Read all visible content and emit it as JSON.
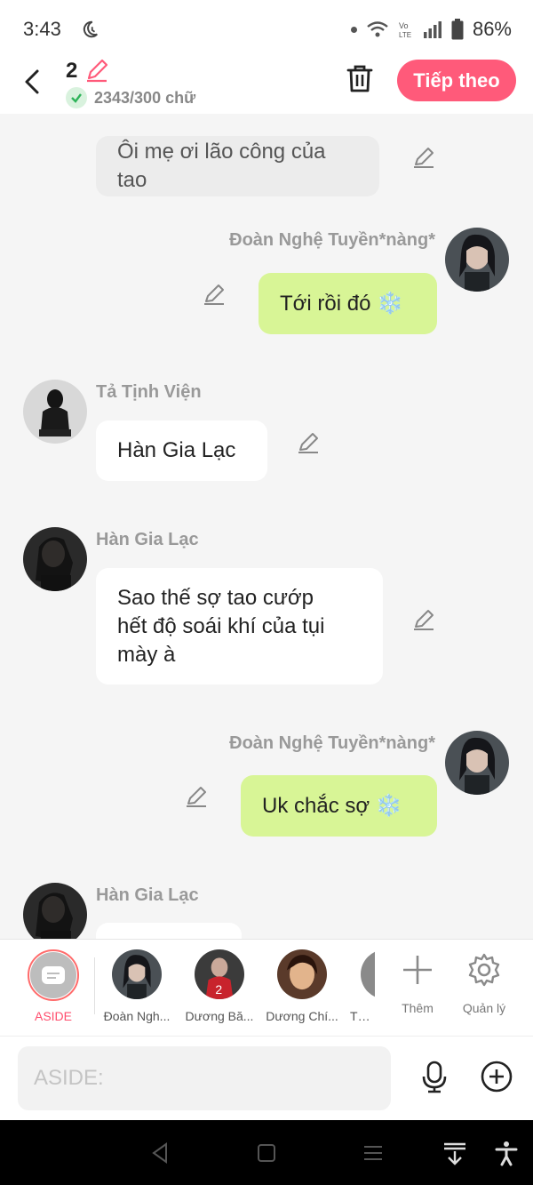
{
  "status": {
    "time": "3:43",
    "battery": "86%"
  },
  "header": {
    "chapter_number": "2",
    "word_count": "2343/300 chữ",
    "next_label": "Tiếp theo"
  },
  "messages": [
    {
      "text": "Ôi mẹ ơi lão công của tao"
    },
    {
      "sender": "Đoàn Nghệ Tuyền*nàng*",
      "text": "Tới rồi đó ❄️"
    },
    {
      "sender": "Tả Tịnh Viện",
      "text": "Hàn Gia Lạc"
    },
    {
      "sender": "Hàn Gia Lạc",
      "lines": [
        "Sao thế sợ tao cướp",
        "hết độ soái khí của tụi",
        "mày à"
      ]
    },
    {
      "sender": "Đoàn Nghệ Tuyền*nàng*",
      "text": "Uk chắc sợ ❄️"
    },
    {
      "sender": "Hàn Gia Lạc"
    }
  ],
  "charbar": {
    "aside_label": "ASIDE",
    "characters": [
      "Đoàn Ngh...",
      "Dương Bă...",
      "Dương Chí...",
      "Tả T"
    ],
    "add_label": "Thêm",
    "manage_label": "Quản lý"
  },
  "input": {
    "placeholder": "ASIDE:"
  },
  "colors": {
    "accent": "#ff5a7a",
    "green_bubble": "#d8f596",
    "aside_red": "#ff4d6d"
  }
}
